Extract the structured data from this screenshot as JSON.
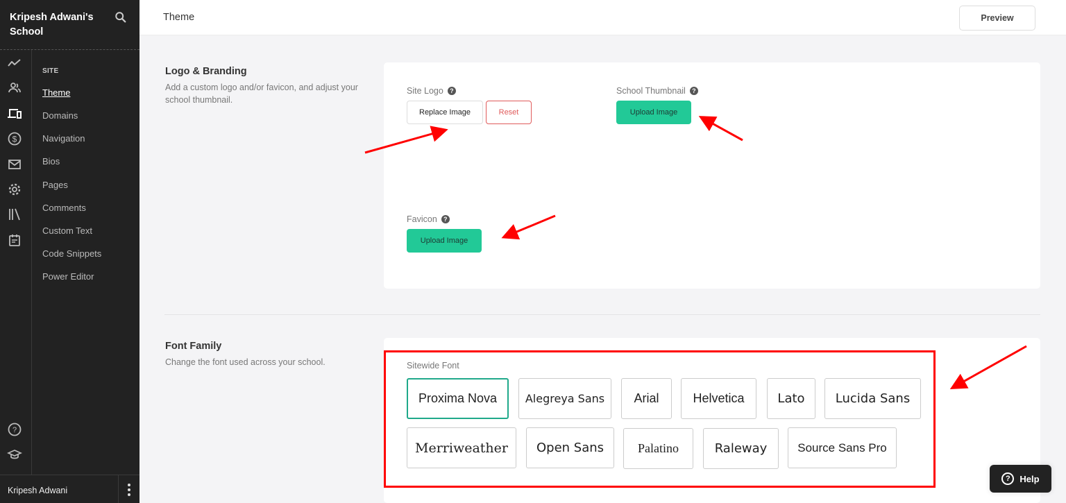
{
  "sidebar": {
    "school_name": "Kripesh Adwani's School",
    "section_label": "SITE",
    "items": [
      {
        "label": "Theme",
        "active": true
      },
      {
        "label": "Domains"
      },
      {
        "label": "Navigation"
      },
      {
        "label": "Bios"
      },
      {
        "label": "Pages"
      },
      {
        "label": "Comments"
      },
      {
        "label": "Custom Text"
      },
      {
        "label": "Code Snippets"
      },
      {
        "label": "Power Editor"
      }
    ],
    "rail_icons": [
      "analytics-icon",
      "users-icon",
      "site-icon",
      "sales-icon",
      "email-icon",
      "settings-icon",
      "library-icon",
      "calendar-icon"
    ],
    "bottom_icons": [
      "help-circle-icon",
      "graduation-cap-icon"
    ],
    "user_name": "Kripesh Adwani"
  },
  "header": {
    "title": "Theme",
    "preview_label": "Preview"
  },
  "logo_branding": {
    "title": "Logo & Branding",
    "description": "Add a custom logo and/or favicon, and adjust your school thumbnail.",
    "site_logo": {
      "label": "Site Logo",
      "replace_label": "Replace Image",
      "reset_label": "Reset"
    },
    "school_thumbnail": {
      "label": "School Thumbnail",
      "upload_label": "Upload Image"
    },
    "favicon": {
      "label": "Favicon",
      "upload_label": "Upload Image"
    }
  },
  "font_family": {
    "title": "Font Family",
    "description": "Change the font used across your school.",
    "field_label": "Sitewide Font",
    "selected": "Proxima Nova",
    "options": [
      "Proxima Nova",
      "Alegreya Sans",
      "Arial",
      "Helvetica",
      "Lato",
      "Lucida Sans",
      "Merriweather",
      "Open Sans",
      "Palatino",
      "Raleway",
      "Source Sans Pro"
    ]
  },
  "help": {
    "label": "Help"
  },
  "colors": {
    "accent_green": "#22c997",
    "selected_border": "#1fa98a",
    "reset_red": "#e05a5a",
    "annotation_red": "#ff0000",
    "sidebar_bg": "#222222"
  }
}
